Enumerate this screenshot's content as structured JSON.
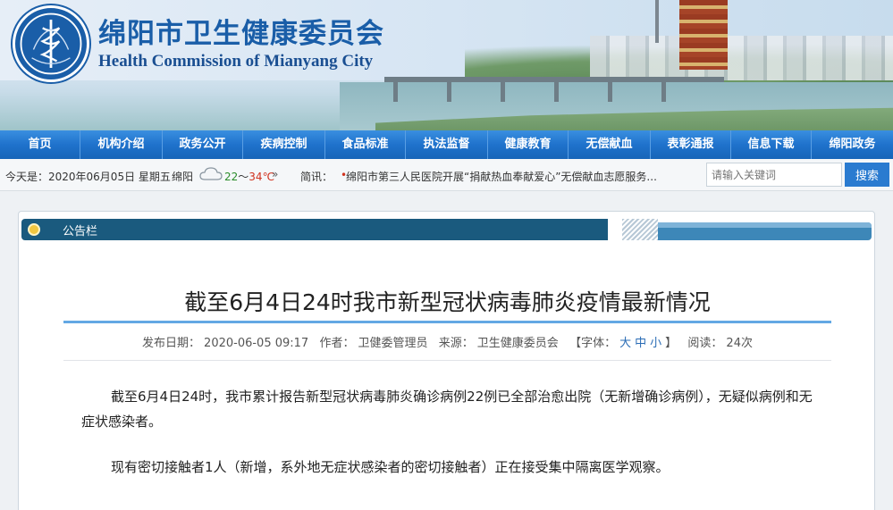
{
  "header": {
    "title_cn": "绵阳市卫生健康委员会",
    "title_en": "Health Commission of Mianyang City",
    "logo_icon": "caduceus-emblem-icon"
  },
  "nav": {
    "items": [
      {
        "label": "首页"
      },
      {
        "label": "机构介绍"
      },
      {
        "label": "政务公开"
      },
      {
        "label": "疾病控制"
      },
      {
        "label": "食品标准"
      },
      {
        "label": "执法监督"
      },
      {
        "label": "健康教育"
      },
      {
        "label": "无偿献血"
      },
      {
        "label": "表彰通报"
      },
      {
        "label": "信息下载"
      },
      {
        "label": "绵阳政务"
      }
    ]
  },
  "infobar": {
    "today": "今天是：2020年06月05日 星期五",
    "city": "绵阳",
    "weather_icon": "cloud-icon",
    "temp_low": "22",
    "temp_sep": "～",
    "temp_high": "34℃",
    "more": "»",
    "news_label": "简讯：",
    "news_bullet": "•",
    "news_text": "绵阳市第三人民医院开展“捐献热血奉献爱心”无偿献血志愿服务..."
  },
  "search": {
    "placeholder": "请输入关键词",
    "button": "搜索"
  },
  "panel": {
    "tab_label": "公告栏"
  },
  "article": {
    "title": "截至6月4日24时我市新型冠状病毒肺炎疫情最新情况",
    "meta": {
      "date_label": "发布日期：",
      "date": "2020-06-05 09:17",
      "author_label": "作者：",
      "author": "卫健委管理员",
      "source_label": "来源：",
      "source": "卫生健康委员会",
      "font_label": "【字体：",
      "font_large": "大",
      "font_medium": "中",
      "font_small": "小",
      "font_close": "】",
      "views_label": "阅读：",
      "views": "24次"
    },
    "paragraphs": [
      "截至6月4日24时，我市累计报告新型冠状病毒肺炎确诊病例22例已全部治愈出院（无新增确诊病例），无疑似病例和无症状感染者。",
      "现有密切接触者1人（新增，系外地无症状感染者的密切接触者）正在接受集中隔离医学观察。"
    ]
  }
}
